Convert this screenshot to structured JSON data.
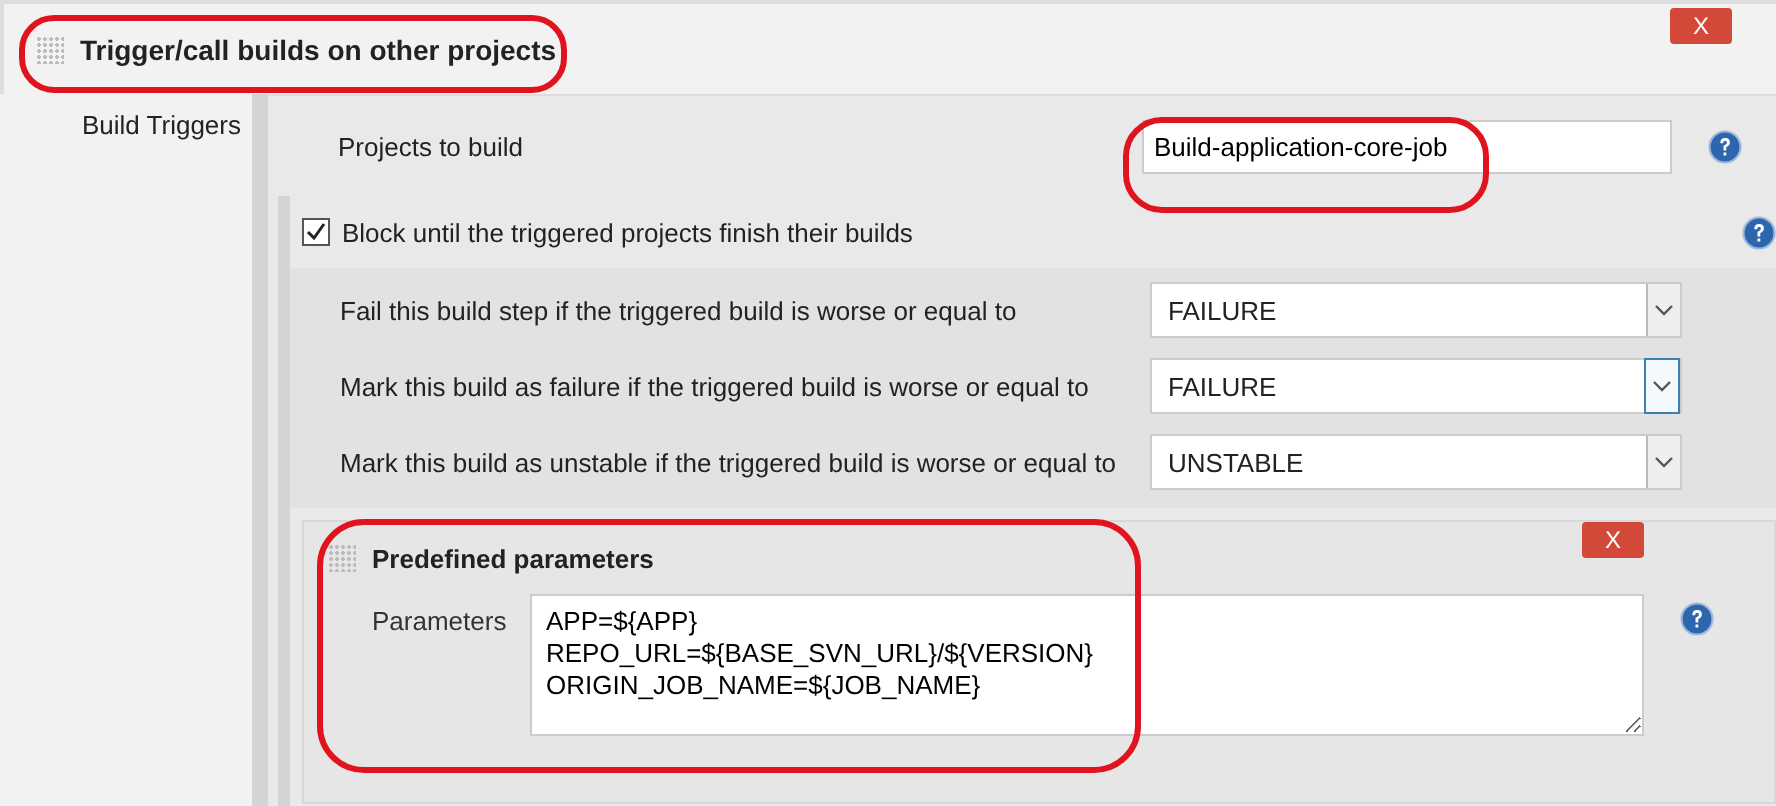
{
  "section": {
    "title": "Trigger/call builds on other projects",
    "delete_label": "X",
    "side_label": "Build Triggers"
  },
  "projects": {
    "label": "Projects to build",
    "value": "Build-application-core-job"
  },
  "block": {
    "label": "Block until the triggered projects finish their builds",
    "checked": true
  },
  "thresholds": [
    {
      "label": "Fail this build step if the triggered build is worse or equal to",
      "value": "FAILURE",
      "focused": false
    },
    {
      "label": "Mark this build as failure if the triggered build is worse or equal to",
      "value": "FAILURE",
      "focused": true
    },
    {
      "label": "Mark this build as unstable if the triggered build is worse or equal to",
      "value": "UNSTABLE",
      "focused": false
    }
  ],
  "predefined": {
    "title": "Predefined parameters",
    "delete_label": "X",
    "label": "Parameters",
    "value": "APP=${APP}\nREPO_URL=${BASE_SVN_URL}/${VERSION}\nORIGIN_JOB_NAME=${JOB_NAME}"
  }
}
